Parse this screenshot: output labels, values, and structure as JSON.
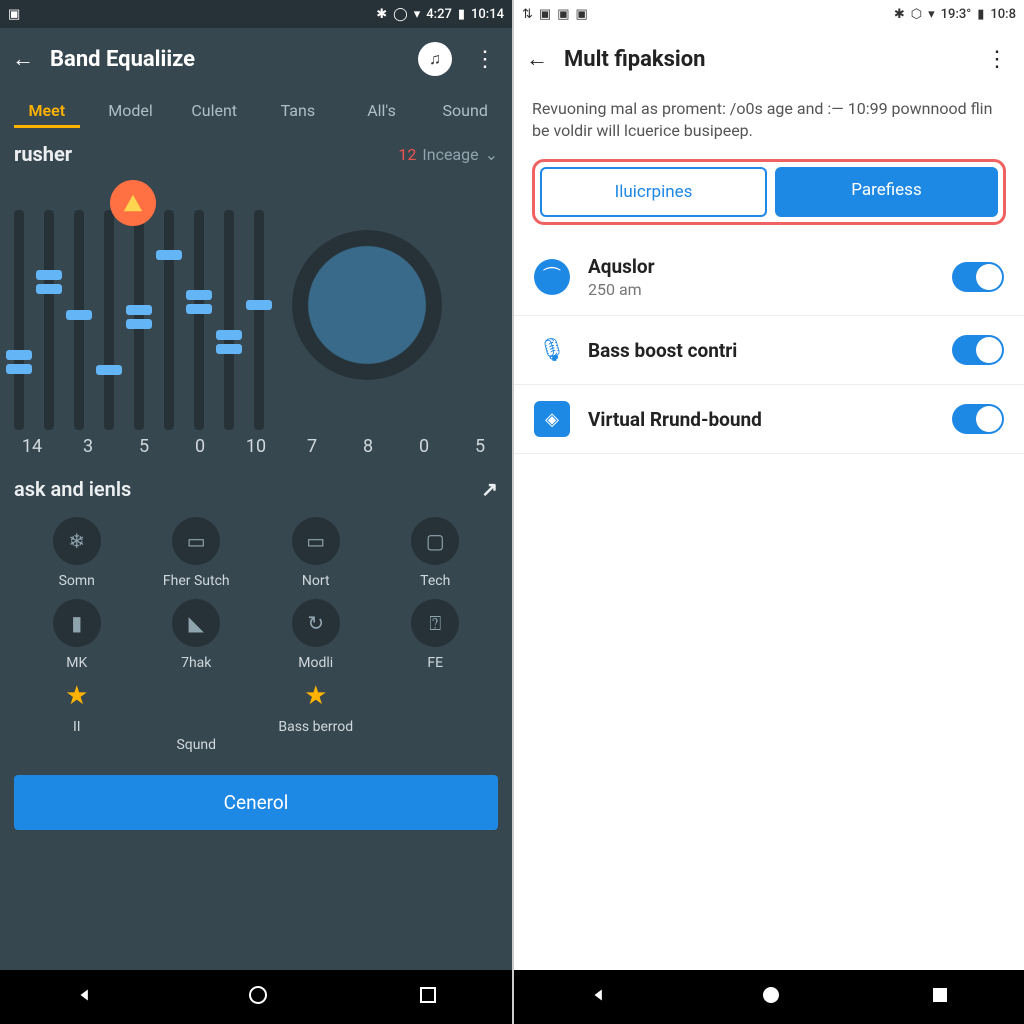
{
  "left": {
    "status": {
      "time1": "4:27",
      "time2": "10:14"
    },
    "title": "Band Equaliize",
    "action_glyph": "♫",
    "tabs": [
      "Meet",
      "Model",
      "Culent",
      "Tans",
      "All's",
      "Sound"
    ],
    "active_tab": 0,
    "section": {
      "name": "rusher",
      "badge": "12",
      "mode": "Inceage"
    },
    "sliders": [
      {
        "i": 0,
        "pos": 140,
        "dbl": true
      },
      {
        "i": 1,
        "pos": 60,
        "dbl": true
      },
      {
        "i": 2,
        "pos": 100,
        "dbl": false
      },
      {
        "i": 3,
        "pos": 155,
        "dbl": false
      },
      {
        "i": 4,
        "pos": 95,
        "dbl": true
      },
      {
        "i": 5,
        "pos": 40,
        "dbl": false
      },
      {
        "i": 6,
        "pos": 80,
        "dbl": true
      },
      {
        "i": 7,
        "pos": 120,
        "dbl": true
      },
      {
        "i": 8,
        "pos": 90,
        "dbl": false
      }
    ],
    "scale": [
      "14",
      "3",
      "5",
      "0",
      "10",
      "7",
      "8",
      "0",
      "5"
    ],
    "section2": "ask and ienls",
    "grid": [
      {
        "label": "Somn",
        "kind": "ic",
        "glyph": "❄"
      },
      {
        "label": "Fher Sutch",
        "kind": "ic",
        "glyph": "▭"
      },
      {
        "label": "Nort",
        "kind": "ic",
        "glyph": "▭"
      },
      {
        "label": "Tech",
        "kind": "ic",
        "glyph": "▢"
      },
      {
        "label": "MK",
        "kind": "ic",
        "glyph": "▮"
      },
      {
        "label": "7hak",
        "kind": "ic",
        "glyph": "◣"
      },
      {
        "label": "Modli",
        "kind": "ic",
        "glyph": "↻"
      },
      {
        "label": "FE",
        "kind": "ic",
        "glyph": "⍰"
      },
      {
        "label": "II",
        "kind": "star",
        "glyph": "★"
      },
      {
        "label": "Sqund",
        "kind": "none",
        "glyph": ""
      },
      {
        "label": "Bass berrod",
        "kind": "star",
        "glyph": "★"
      }
    ],
    "button": "Cenerol"
  },
  "right": {
    "status": {
      "time1": "19:3°",
      "time2": "10:8"
    },
    "title": "Mult fipaksion",
    "desc": "Revuoning mal as proment: /o0s age and :— 10:99 pownnood flin be voldir will lcuerice busipeep.",
    "seg": {
      "a": "Iluicrpines",
      "b": "Parefiess"
    },
    "rows": [
      {
        "title": "Aquslor",
        "sub": "250 am",
        "icon": "headphones"
      },
      {
        "title": "Bass boost contri",
        "sub": "",
        "icon": "mic"
      },
      {
        "title": "Virtual Rrund-bound",
        "sub": "",
        "icon": "surround"
      }
    ]
  }
}
